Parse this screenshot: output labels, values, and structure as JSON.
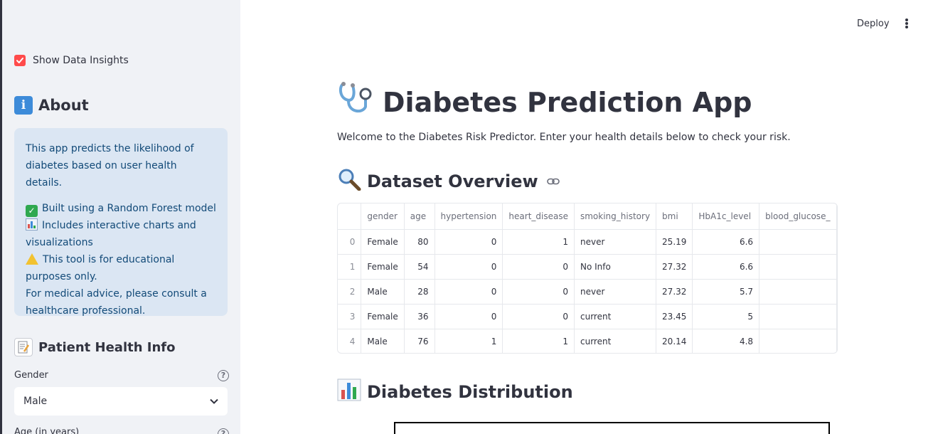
{
  "sidebar": {
    "show_insights": {
      "label": "Show Data Insights",
      "checked": true
    },
    "about": {
      "heading": "About",
      "icon": "info-icon",
      "description": "This app predicts the likelihood of diabetes based on user health details.",
      "line1": "Built using a Random Forest model",
      "line2": "Includes interactive charts and visualizations",
      "line3": "This tool is for educational purposes only.",
      "line4": "For medical advice, please consult a healthcare professional."
    },
    "patient_info": {
      "heading": "Patient Health Info",
      "gender_label": "Gender",
      "gender_value": "Male",
      "age_label": "Age (in years)"
    }
  },
  "header": {
    "deploy_label": "Deploy"
  },
  "main": {
    "title": "Diabetes Prediction App",
    "welcome": "Welcome to the Diabetes Risk Predictor. Enter your health details below to check your risk.",
    "dataset_heading": "Dataset Overview",
    "distribution_heading": "Diabetes Distribution",
    "table": {
      "columns": [
        "",
        "gender",
        "age",
        "hypertension",
        "heart_disease",
        "smoking_history",
        "bmi",
        "HbA1c_level",
        "blood_glucose_"
      ],
      "rows": [
        [
          "0",
          "Female",
          "80",
          "0",
          "1",
          "never",
          "25.19",
          "6.6",
          ""
        ],
        [
          "1",
          "Female",
          "54",
          "0",
          "0",
          "No Info",
          "27.32",
          "6.6",
          ""
        ],
        [
          "2",
          "Male",
          "28",
          "0",
          "0",
          "never",
          "27.32",
          "5.7",
          ""
        ],
        [
          "3",
          "Female",
          "36",
          "0",
          "0",
          "current",
          "23.45",
          "5",
          ""
        ],
        [
          "4",
          "Male",
          "76",
          "1",
          "1",
          "current",
          "20.14",
          "4.8",
          ""
        ]
      ]
    }
  },
  "colors": {
    "accent": "#ff4b4b",
    "info_bg": "#dbe6f3",
    "info_text": "#124a78",
    "sidebar_bg": "#f0f2f6"
  }
}
